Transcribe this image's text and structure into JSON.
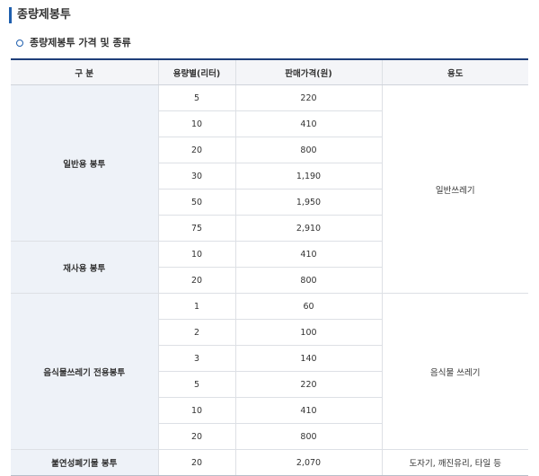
{
  "page_title": "종량제봉투",
  "section_title": "종량제봉투 가격 및 종류",
  "table": {
    "headers": [
      "구 분",
      "용량별(리터)",
      "판매가격(원)",
      "용도"
    ],
    "groups": [
      {
        "category": "일반용 봉투",
        "rows": [
          {
            "capacity": "5",
            "price": "220"
          },
          {
            "capacity": "10",
            "price": "410"
          },
          {
            "capacity": "20",
            "price": "800"
          },
          {
            "capacity": "30",
            "price": "1,190"
          },
          {
            "capacity": "50",
            "price": "1,950"
          },
          {
            "capacity": "75",
            "price": "2,910"
          }
        ]
      },
      {
        "category": "재사용 봉투",
        "rows": [
          {
            "capacity": "10",
            "price": "410"
          },
          {
            "capacity": "20",
            "price": "800"
          }
        ]
      },
      {
        "category": "음식물쓰레기 전용봉투",
        "rows": [
          {
            "capacity": "1",
            "price": "60"
          },
          {
            "capacity": "2",
            "price": "100"
          },
          {
            "capacity": "3",
            "price": "140"
          },
          {
            "capacity": "5",
            "price": "220"
          },
          {
            "capacity": "10",
            "price": "410"
          },
          {
            "capacity": "20",
            "price": "800"
          }
        ]
      },
      {
        "category": "불연성폐기물 봉투",
        "rows": [
          {
            "capacity": "20",
            "price": "2,070"
          }
        ]
      }
    ],
    "usages": [
      {
        "label": "일반쓰레기"
      },
      {
        "label": "음식물 쓰레기"
      },
      {
        "label": "도자기, 깨진유리, 타일 등"
      }
    ]
  }
}
